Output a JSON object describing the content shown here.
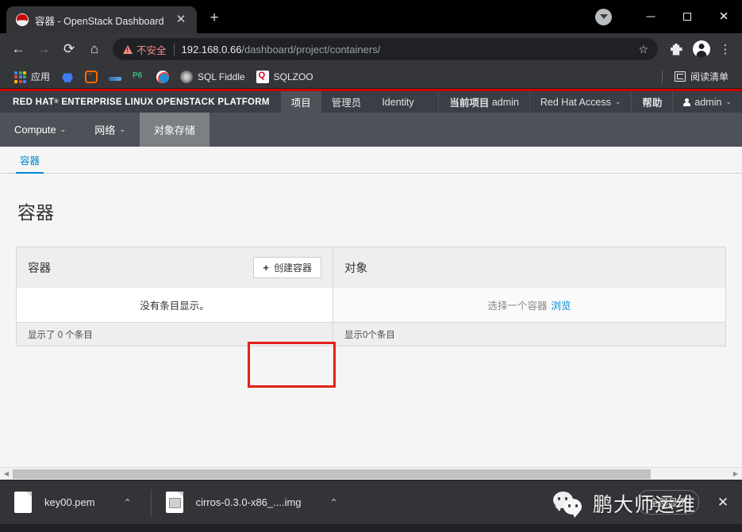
{
  "browser": {
    "tab": {
      "title": "容器 - OpenStack Dashboard",
      "favicon": "redhat-favicon",
      "close": "✕"
    },
    "new_tab": "+",
    "window_controls": {
      "minimize": "—",
      "maximize": "□",
      "close": "✕",
      "profile_chevron": "▼"
    },
    "nav": {
      "back": "←",
      "forward": "→",
      "reload": "⟳",
      "home": "⌂"
    },
    "omnibox": {
      "security_label": "不安全",
      "url_host": "192.168.0.66",
      "url_path": "/dashboard/project/containers/",
      "star": "☆"
    },
    "toolbar_icons": {
      "extensions": "extensions-icon",
      "profile": "profile-icon",
      "menu": "⋮"
    },
    "bookmarks": [
      {
        "label": "应用",
        "icon": "apps-grid-icon"
      },
      {
        "label": "",
        "icon": "blue-pentagon-icon"
      },
      {
        "label": "",
        "icon": "orange-bracket-icon"
      },
      {
        "label": "",
        "icon": "blue-pen-icon"
      },
      {
        "label": "",
        "icon": "p6-icon"
      },
      {
        "label": "",
        "icon": "browser-eye-icon"
      },
      {
        "label": "SQL Fiddle",
        "icon": "sql-fiddle-icon"
      },
      {
        "label": "SQLZOO",
        "icon": "sqlzoo-icon"
      }
    ],
    "reading_list": {
      "label": "阅读清单",
      "icon": "reading-list-icon"
    }
  },
  "openstack": {
    "brand": {
      "red_hat": "RED HAT",
      "trademark": "®",
      "rest": "ENTERPRISE LINUX OPENSTACK PLATFORM"
    },
    "top_nav": [
      {
        "label": "项目",
        "active": true
      },
      {
        "label": "管理员",
        "active": false
      },
      {
        "label": "Identity",
        "active": false
      }
    ],
    "top_right": [
      {
        "label_bold": "当前项目",
        "label": "admin",
        "caret": ""
      },
      {
        "label_bold": "",
        "label": "Red Hat Access",
        "caret": "⌄"
      },
      {
        "label_bold": "帮助",
        "label": "",
        "caret": ""
      },
      {
        "label_bold": "",
        "label": "admin",
        "caret": "⌄",
        "icon": "user-icon"
      }
    ],
    "sub_nav": [
      {
        "label": "Compute",
        "caret": "⌄",
        "active": false
      },
      {
        "label": "网络",
        "caret": "⌄",
        "active": false
      },
      {
        "label": "对象存储",
        "caret": "",
        "active": true
      }
    ],
    "page_tabs": [
      {
        "label": "容器",
        "active": true
      }
    ],
    "page_title": "容器",
    "containers_panel": {
      "header": "容器",
      "create_button": {
        "icon": "+",
        "label": "创建容器"
      },
      "empty_message": "没有条目显示。",
      "footer": "显示了 0 个条目"
    },
    "objects_panel": {
      "header": "对象",
      "empty_message": "选择一个容器",
      "empty_link": "浏览",
      "footer": "显示0个条目"
    }
  },
  "annotation": {
    "color": "#e32119",
    "target": "创建容器"
  },
  "scrollbar": {
    "left_arrow": "◀",
    "right_arrow": "▶"
  },
  "downloads": {
    "items": [
      {
        "name": "key00.pem",
        "icon": "file-icon",
        "caret": "⌃"
      },
      {
        "name": "cirros-0.3.0-x86_....img",
        "icon": "image-file-icon",
        "caret": "⌃"
      }
    ],
    "show_all": "全部显示",
    "close": "✕"
  },
  "watermark": {
    "text": "鹏大师运维",
    "logo": "wechat-icon"
  }
}
